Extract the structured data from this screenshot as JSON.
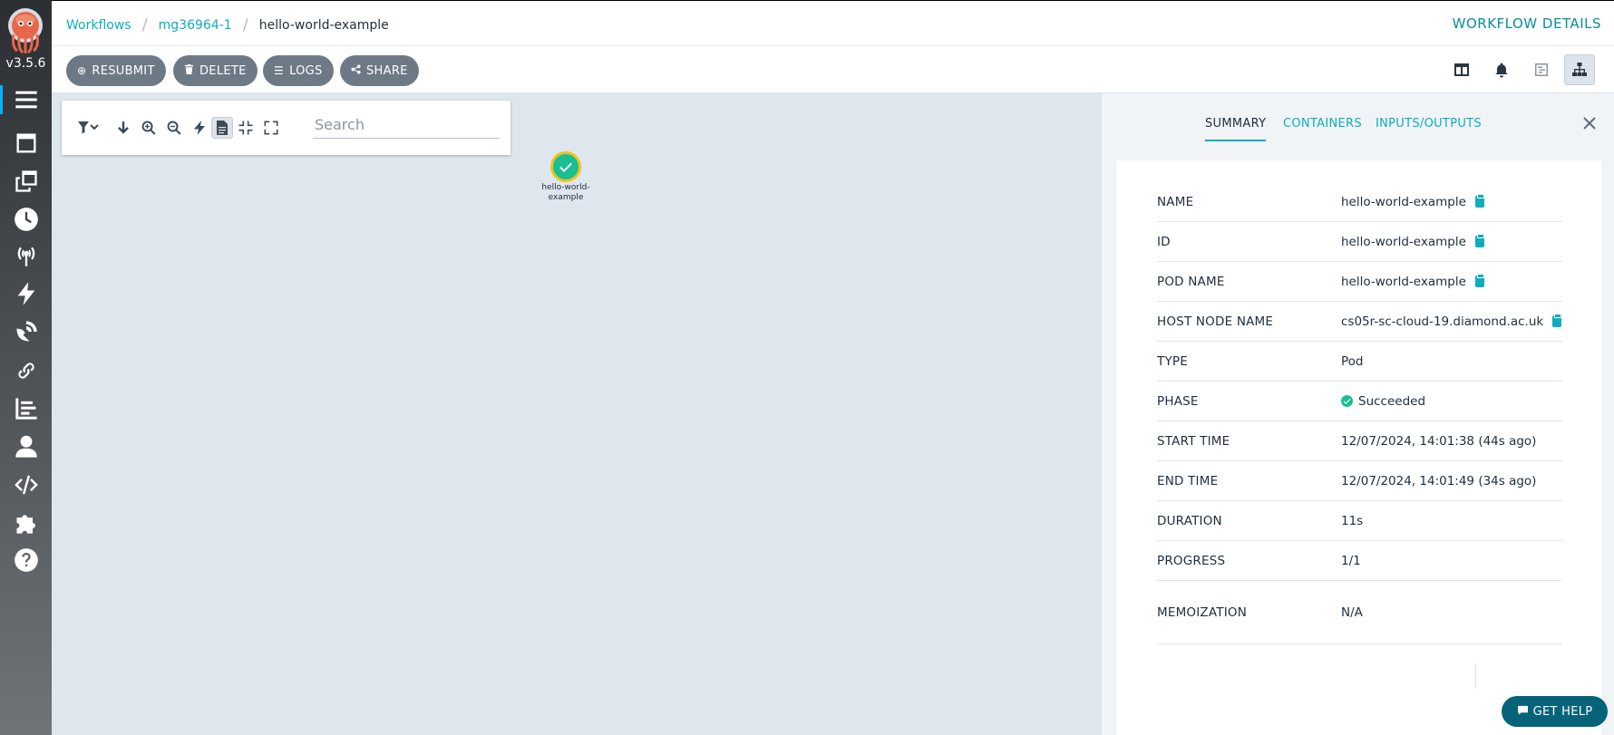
{
  "app": {
    "version": "v3.5.6"
  },
  "breadcrumb": [
    {
      "label": "Workflows"
    },
    {
      "label": "mg36964-1"
    },
    {
      "label": "hello-world-example"
    }
  ],
  "page_title": "WORKFLOW DETAILS",
  "actions": {
    "resubmit": "RESUBMIT",
    "delete": "DELETE",
    "logs": "LOGS",
    "share": "SHARE"
  },
  "graph": {
    "search_placeholder": "Search",
    "node": {
      "label": "hello-world-example",
      "status": "succeeded"
    }
  },
  "panel": {
    "tabs": [
      "SUMMARY",
      "CONTAINERS",
      "INPUTS/OUTPUTS"
    ],
    "rows": [
      {
        "label": "NAME",
        "value": "hello-world-example"
      },
      {
        "label": "ID",
        "value": "hello-world-example"
      },
      {
        "label": "POD NAME",
        "value": "hello-world-example"
      },
      {
        "label": "HOST NODE NAME",
        "value": "cs05r-sc-cloud-19.diamond.ac.uk"
      },
      {
        "label": "TYPE",
        "value": "Pod"
      },
      {
        "label": "PHASE",
        "value": "Succeeded"
      },
      {
        "label": "START TIME",
        "value": "12/07/2024, 14:01:38 (44s ago)"
      },
      {
        "label": "END TIME",
        "value": "12/07/2024, 14:01:49 (34s ago)"
      },
      {
        "label": "DURATION",
        "value": "11s"
      },
      {
        "label": "PROGRESS",
        "value": "1/1"
      },
      {
        "label": "MEMOIZATION",
        "value": "N/A"
      }
    ]
  },
  "help": {
    "label": "GET HELP"
  },
  "colors": {
    "accent": "#0dadbd",
    "success": "#18be94",
    "button": "#6d7a86"
  }
}
